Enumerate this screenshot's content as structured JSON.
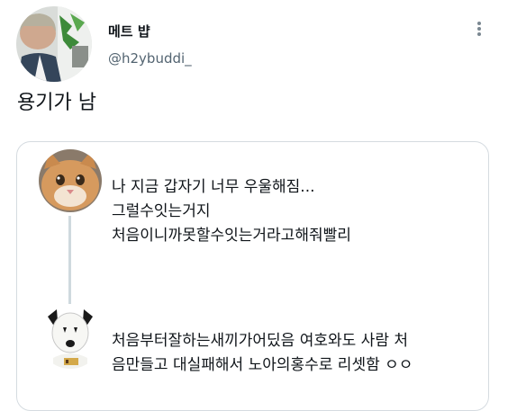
{
  "tweet": {
    "display_name": "메트 뱝",
    "handle": "@h2ybuddi_",
    "text": "용기가 남"
  },
  "quoted_thread": {
    "first_reply": {
      "lines": [
        "나 지금 갑자기 너무 우울해짐...",
        "그럴수잇는거지",
        "처음이니까못할수잇는거라고해줘빨리"
      ]
    },
    "second_reply": {
      "lines": [
        "처음부터잘하는새끼가어딨음 여호와도 사람 처",
        "음만들고 대실패해서 노아의홍수로 리셋함 ㅇㅇ"
      ]
    }
  },
  "icons": {
    "more": "more-icon"
  }
}
